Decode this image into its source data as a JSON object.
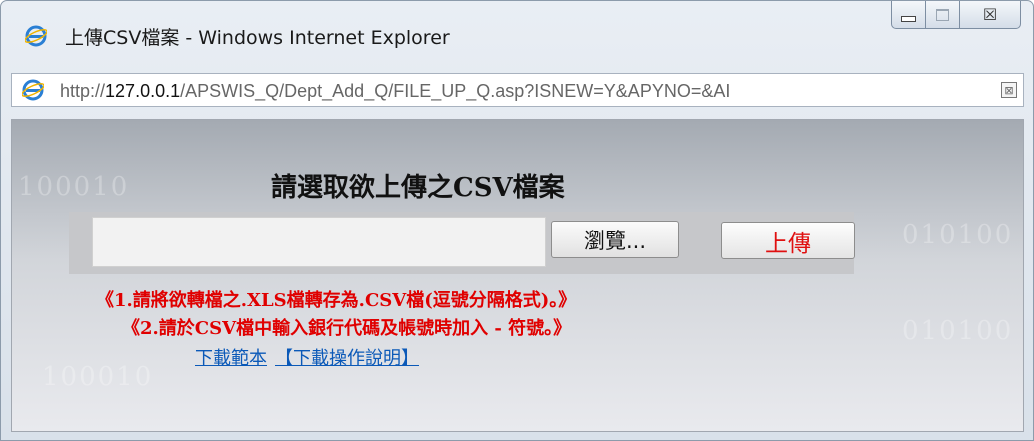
{
  "window": {
    "title": "上傳CSV檔案 - Windows Internet Explorer",
    "minimize_icon": "minimize-icon",
    "maximize_icon": "maximize-icon",
    "close_glyph": "☒",
    "close_icon": "close-icon"
  },
  "address_bar": {
    "url_prefix": "http://",
    "url_host": "127.0.0.1",
    "url_rest": "/APSWIS_Q/Dept_Add_Q/FILE_UP_Q.asp?ISNEW=Y&APYNO=&AI",
    "page_icon": "ie-page-icon",
    "compat_icon": "compatibility-view-icon",
    "compat_glyph": "⊠"
  },
  "page": {
    "heading": "請選取欲上傳之CSV檔案",
    "file_input_value": "",
    "browse_label": "瀏覽...",
    "upload_label": "上傳",
    "note1": "《1.請將欲轉檔之.XLS檔轉存為.CSV檔(逗號分隔格式)。》",
    "note2": "《2.請於CSV檔中輸入銀行代碼及帳號時加入 - 符號。》",
    "link_sample": "下載範本",
    "link_manual": "【下載操作說明】",
    "bg_digits": [
      "100010",
      "010100",
      "010100",
      "100010"
    ]
  },
  "colors": {
    "accent_red": "#e00000",
    "link_blue": "#0b59b8"
  }
}
